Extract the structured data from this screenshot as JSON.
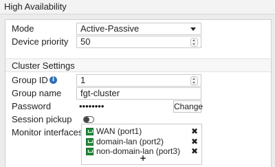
{
  "window": {
    "title": "High Availability"
  },
  "form": {
    "mode": {
      "label": "Mode",
      "value": "Active-Passive"
    },
    "device_priority": {
      "label": "Device priority",
      "value": "50"
    }
  },
  "cluster": {
    "section_title": "Cluster Settings",
    "group_id": {
      "label": "Group ID",
      "value": "1"
    },
    "group_name": {
      "label": "Group name",
      "value": "fgt-cluster"
    },
    "password": {
      "label": "Password",
      "value": "••••••••",
      "button": "Change"
    },
    "session_pickup": {
      "label": "Session pickup",
      "enabled": false
    },
    "monitor_interfaces": {
      "label": "Monitor interfaces",
      "items": [
        {
          "label": "WAN (port1)"
        },
        {
          "label": "domain-lan (port2)"
        },
        {
          "label": "non-domain-lan (port3)"
        }
      ],
      "add_symbol": "+",
      "remove_symbol": "✖"
    }
  },
  "colors": {
    "info_icon": "#2d6fb6",
    "interface_icon": "#1f8c3a"
  },
  "icons": {
    "info": "info-icon",
    "interface": "network-port-icon",
    "remove": "close-icon",
    "add": "plus-icon"
  }
}
